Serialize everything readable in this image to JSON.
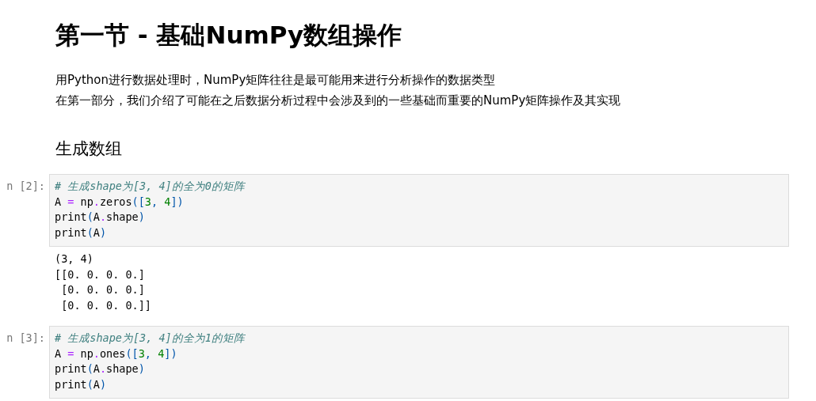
{
  "title": "第一节 - 基础NumPy数组操作",
  "intro": [
    "用Python进行数据处理时，NumPy矩阵往往是最可能用来进行分析操作的数据类型",
    "在第一部分，我们介绍了可能在之后数据分析过程中会涉及到的一些基础而重要的NumPy矩阵操作及其实现"
  ],
  "section": "生成数组",
  "cells": [
    {
      "prompt": "n [2]:",
      "code": [
        [
          {
            "kind": "comment",
            "text": "# 生成shape为[3, 4]的全为0的矩阵"
          }
        ],
        [
          {
            "kind": "name",
            "text": "A "
          },
          {
            "kind": "op",
            "text": "="
          },
          {
            "kind": "name",
            "text": " np"
          },
          {
            "kind": "op",
            "text": "."
          },
          {
            "kind": "name",
            "text": "zeros"
          },
          {
            "kind": "paren",
            "text": "(["
          },
          {
            "kind": "num",
            "text": "3"
          },
          {
            "kind": "paren",
            "text": ", "
          },
          {
            "kind": "num",
            "text": "4"
          },
          {
            "kind": "paren",
            "text": "])"
          }
        ],
        [
          {
            "kind": "name",
            "text": "print"
          },
          {
            "kind": "paren",
            "text": "("
          },
          {
            "kind": "name",
            "text": "A"
          },
          {
            "kind": "op",
            "text": "."
          },
          {
            "kind": "name",
            "text": "shape"
          },
          {
            "kind": "paren",
            "text": ")"
          }
        ],
        [
          {
            "kind": "name",
            "text": "print"
          },
          {
            "kind": "paren",
            "text": "("
          },
          {
            "kind": "name",
            "text": "A"
          },
          {
            "kind": "paren",
            "text": ")"
          }
        ]
      ],
      "output": [
        "(3, 4)",
        "[[0. 0. 0. 0.]",
        " [0. 0. 0. 0.]",
        " [0. 0. 0. 0.]]"
      ]
    },
    {
      "prompt": "n [3]:",
      "code": [
        [
          {
            "kind": "comment",
            "text": "# 生成shape为[3, 4]的全为1的矩阵"
          }
        ],
        [
          {
            "kind": "name",
            "text": "A "
          },
          {
            "kind": "op",
            "text": "="
          },
          {
            "kind": "name",
            "text": " np"
          },
          {
            "kind": "op",
            "text": "."
          },
          {
            "kind": "name",
            "text": "ones"
          },
          {
            "kind": "paren",
            "text": "(["
          },
          {
            "kind": "num",
            "text": "3"
          },
          {
            "kind": "paren",
            "text": ", "
          },
          {
            "kind": "num",
            "text": "4"
          },
          {
            "kind": "paren",
            "text": "])"
          }
        ],
        [
          {
            "kind": "name",
            "text": "print"
          },
          {
            "kind": "paren",
            "text": "("
          },
          {
            "kind": "name",
            "text": "A"
          },
          {
            "kind": "op",
            "text": "."
          },
          {
            "kind": "name",
            "text": "shape"
          },
          {
            "kind": "paren",
            "text": ")"
          }
        ],
        [
          {
            "kind": "name",
            "text": "print"
          },
          {
            "kind": "paren",
            "text": "("
          },
          {
            "kind": "name",
            "text": "A"
          },
          {
            "kind": "paren",
            "text": ")"
          }
        ]
      ]
    }
  ]
}
